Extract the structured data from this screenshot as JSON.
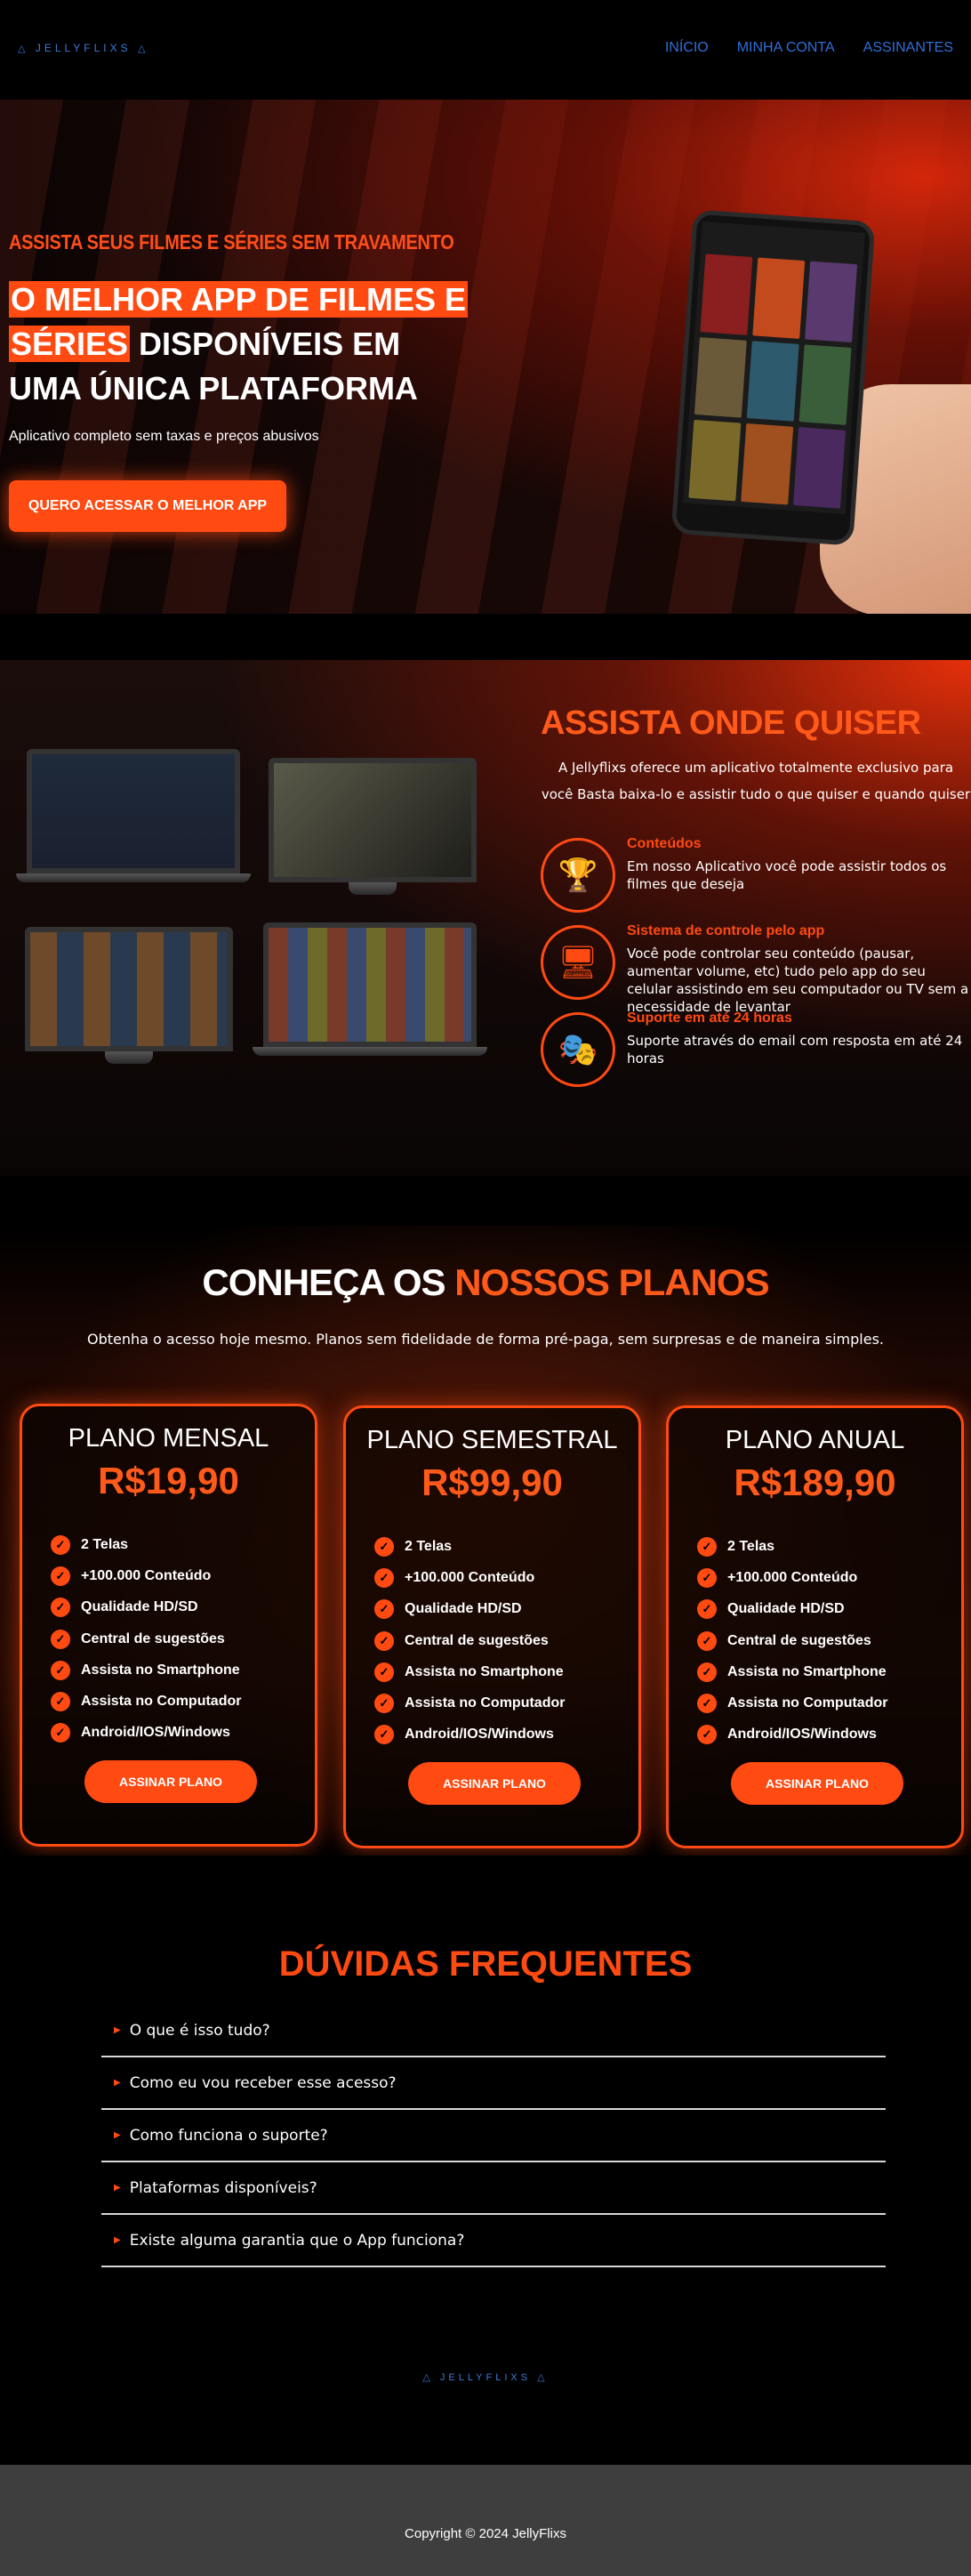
{
  "nav": {
    "logo": "JELLYFLIXS",
    "links": [
      "INÍCIO",
      "MINHA CONTA",
      "ASSINANTES"
    ]
  },
  "hero": {
    "subtitle": "ASSISTA SEUS FILMES E SÉRIES SEM TRAVAMENTO",
    "title_highlight_1": "O MELHOR APP DE FILMES E",
    "title_highlight_2": "SÉRIES",
    "title_rest": " DISPONÍVEIS EM UMA ÚNICA PLATAFORMA",
    "description": "Aplicativo completo sem taxas e preços abusivos",
    "cta": "QUERO ACESSAR O MELHOR APP"
  },
  "watch": {
    "title": "ASSISTA ONDE QUISER",
    "description": "A Jellyflixs oferece um aplicativo totalmente exclusivo para você Basta baixa-lo e assistir tudo o que quiser e quando quiser",
    "features": [
      {
        "icon": "trophy-icon",
        "title": "Conteúdos",
        "text": "Em nosso Aplicativo você pode assistir todos os filmes que deseja"
      },
      {
        "icon": "remote-control-icon",
        "title": "Sistema de controle pelo app",
        "text": "Você pode controlar seu conteúdo (pausar, aumentar volume, etc) tudo pelo app do seu celular assistindo em seu computador ou TV sem a necessidade de levantar"
      },
      {
        "icon": "theater-masks-icon",
        "title": "Suporte em até 24 horas",
        "text": "Suporte através do email com resposta em até 24 horas"
      }
    ]
  },
  "plans": {
    "title_white": "CONHEÇA OS ",
    "title_orange": "NOSSOS PLANOS",
    "description": "Obtenha o acesso hoje mesmo. Planos sem fidelidade de forma pré-paga, sem surpresas e de maneira simples.",
    "items": [
      {
        "name": "PLANO MENSAL",
        "price": "R$19,90",
        "features": [
          "2 Telas",
          "+100.000 Conteúdo",
          "Qualidade HD/SD",
          "Central de sugestões",
          "Assista no Smartphone",
          "Assista no Computador",
          "Android/IOS/Windows"
        ],
        "button": "ASSINAR PLANO"
      },
      {
        "name": "PLANO SEMESTRAL",
        "price": "R$99,90",
        "features": [
          "2 Telas",
          "+100.000 Conteúdo",
          "Qualidade HD/SD",
          "Central de sugestões",
          "Assista no Smartphone",
          "Assista no Computador",
          "Android/IOS/Windows"
        ],
        "button": "ASSINAR PLANO"
      },
      {
        "name": "PLANO ANUAL",
        "price": "R$189,90",
        "features": [
          "2 Telas",
          "+100.000 Conteúdo",
          "Qualidade HD/SD",
          "Central de sugestões",
          "Assista no Smartphone",
          "Assista no Computador",
          "Android/IOS/Windows"
        ],
        "button": "ASSINAR PLANO"
      }
    ]
  },
  "faq": {
    "title": "DÚVIDAS FREQUENTES",
    "items": [
      "O que é isso tudo?",
      "Como eu vou receber esse acesso?",
      "Como funciona o suporte?",
      "Plataformas disponíveis?",
      "Existe alguma garantia que o App funciona?"
    ]
  },
  "footer": {
    "logo": "JELLYFLIXS",
    "copyright": "Copyright © 2024 JellyFlixs"
  },
  "colors": {
    "accent": "#ff4a12",
    "nav_link": "#2f6fd8",
    "footer_bg": "#3e3e3e"
  }
}
